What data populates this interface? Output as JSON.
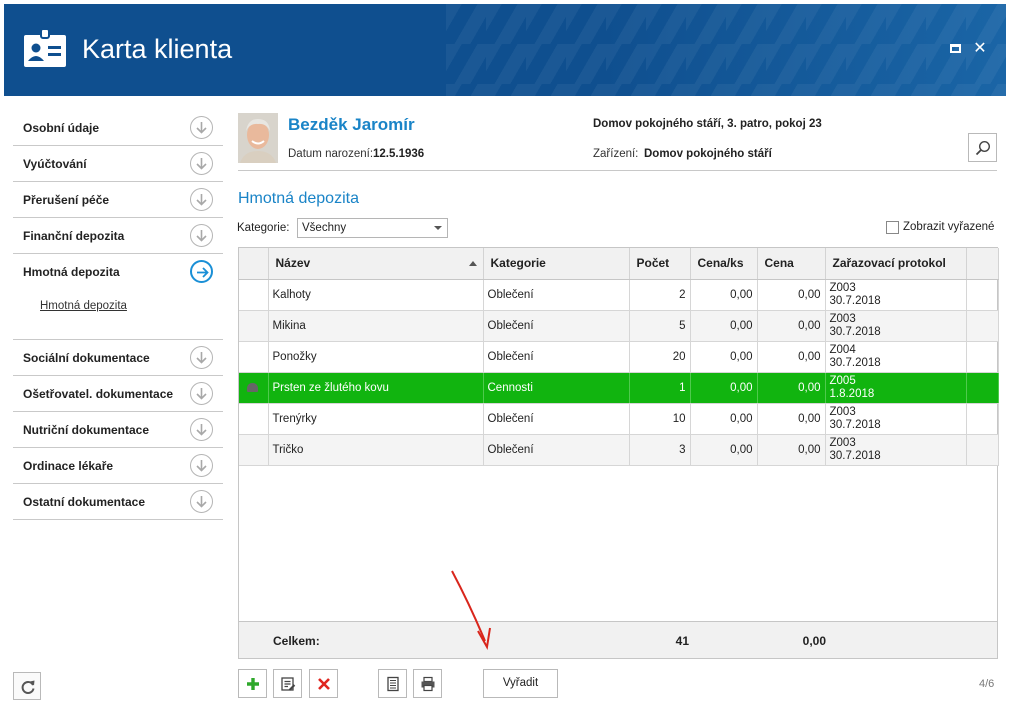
{
  "window": {
    "title": "Karta klienta"
  },
  "sidebar": {
    "items": [
      {
        "label": "Osobní údaje"
      },
      {
        "label": "Vyúčtování"
      },
      {
        "label": "Přerušení péče"
      },
      {
        "label": "Finanční depozita"
      },
      {
        "label": "Hmotná depozita",
        "active": true,
        "sub": "Hmotná depozita"
      },
      {
        "label": "Sociální dokumentace"
      },
      {
        "label": "Ošetřovatel. dokumentace"
      },
      {
        "label": "Nutriční dokumentace"
      },
      {
        "label": "Ordinace lékaře"
      },
      {
        "label": "Ostatní dokumentace"
      }
    ]
  },
  "client": {
    "name": "Bezděk Jaromír",
    "dob_label": "Datum narození:",
    "dob": "12.5.1936",
    "location": "Domov pokojného stáří, 3. patro, pokoj 23",
    "facility_label": "Zařízení:",
    "facility": "Domov pokojného stáří"
  },
  "section": {
    "title": "Hmotná depozita",
    "category_label": "Kategorie:",
    "category_value": "Všechny",
    "show_removed_label": "Zobrazit vyřazené"
  },
  "grid": {
    "columns": [
      "Název",
      "Kategorie",
      "Počet",
      "Cena/ks",
      "Cena",
      "Zařazovací protokol"
    ],
    "rows": [
      {
        "name": "Kalhoty",
        "category": "Oblečení",
        "count": "2",
        "unit_price": "0,00",
        "price": "0,00",
        "protocol": "Z003",
        "date": "30.7.2018"
      },
      {
        "name": "Mikina",
        "category": "Oblečení",
        "count": "5",
        "unit_price": "0,00",
        "price": "0,00",
        "protocol": "Z003",
        "date": "30.7.2018"
      },
      {
        "name": "Ponožky",
        "category": "Oblečení",
        "count": "20",
        "unit_price": "0,00",
        "price": "0,00",
        "protocol": "Z004",
        "date": "30.7.2018"
      },
      {
        "name": "Prsten ze žlutého kovu",
        "category": "Cennosti",
        "count": "1",
        "unit_price": "0,00",
        "price": "0,00",
        "protocol": "Z005",
        "date": "1.8.2018"
      },
      {
        "name": "Trenýrky",
        "category": "Oblečení",
        "count": "10",
        "unit_price": "0,00",
        "price": "0,00",
        "protocol": "Z003",
        "date": "30.7.2018"
      },
      {
        "name": "Tričko",
        "category": "Oblečení",
        "count": "3",
        "unit_price": "0,00",
        "price": "0,00",
        "protocol": "Z003",
        "date": "30.7.2018"
      }
    ],
    "footer": {
      "label": "Celkem:",
      "count": "41",
      "price": "0,00"
    }
  },
  "toolbar": {
    "remove_label": "Vyřadit"
  },
  "pager": {
    "text": "4/6"
  },
  "colors": {
    "header": "#0f4f8f",
    "accent": "#1a84c7",
    "selected_row": "#11b40f",
    "annotation_arrow": "#d9261c"
  }
}
